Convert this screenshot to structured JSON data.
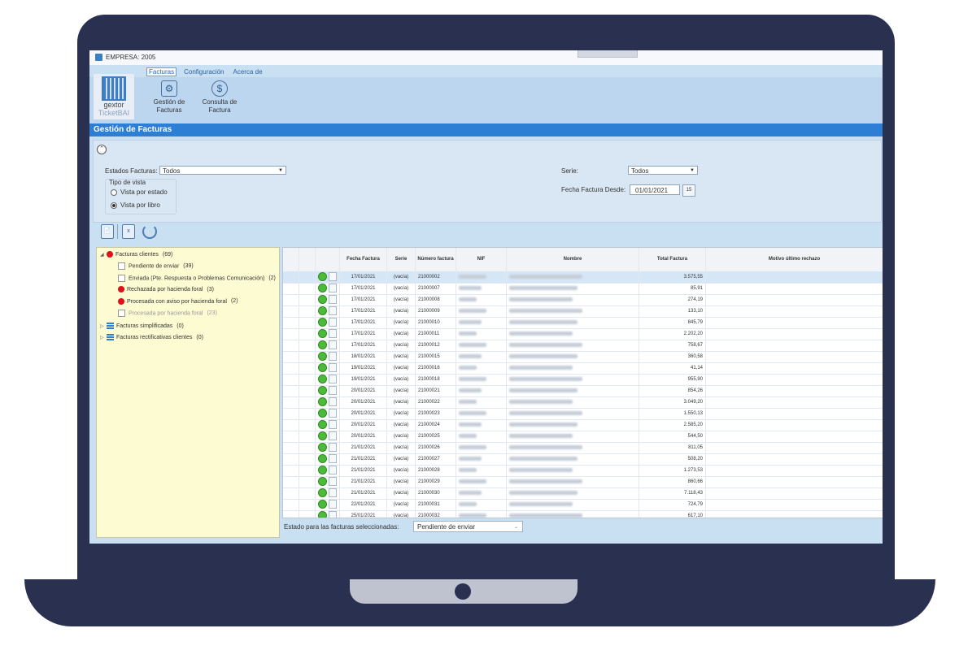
{
  "window": {
    "title": "EMPRESA: 2005"
  },
  "ribbon": {
    "tabs": [
      "Facturas",
      "Configuración",
      "Acerca de"
    ],
    "active_tab": "Facturas",
    "logo": {
      "line1": "gextor",
      "line2": "TicketBAI"
    },
    "buttons": [
      {
        "label1": "Gestión de",
        "label2": "Facturas",
        "icon": "invoice-gear-icon"
      },
      {
        "label1": "Consulta de",
        "label2": "Factura",
        "icon": "invoice-search-icon"
      }
    ]
  },
  "section": {
    "title": "Gestión de Facturas"
  },
  "filters": {
    "estados_label": "Estados Facturas:",
    "estados_value": "Todos",
    "tipo_vista_label": "Tipo de vista",
    "radio_estado": "Vista por estado",
    "radio_libro": "Vista por libro",
    "selected_view": "Vista por libro",
    "serie_label": "Serie:",
    "serie_value": "Todos",
    "fecha_label": "Fecha Factura Desde:",
    "fecha_value": "01/01/2021",
    "cal_label": "15"
  },
  "tree": {
    "root": {
      "label": "Facturas clientes",
      "count": "(69)"
    },
    "children": [
      {
        "label": "Pendiente de enviar",
        "count": "(39)",
        "icon": "checkbox"
      },
      {
        "label": "Enviada (Pte. Respuesta o Problemas Comunicación)",
        "count": "(2)",
        "icon": "checkbox"
      },
      {
        "label": "Rechazada por hacienda foral",
        "count": "(3)",
        "icon": "red"
      },
      {
        "label": "Procesada con aviso por hacienda foral",
        "count": "(2)",
        "icon": "red"
      },
      {
        "label": "Procesada por hacienda foral",
        "count": "(23)",
        "icon": "checkbox-dim"
      }
    ],
    "others": [
      {
        "label": "Facturas simplificadas",
        "count": "(0)"
      },
      {
        "label": "Facturas rectificativas clientes",
        "count": "(0)"
      }
    ]
  },
  "grid": {
    "headers": [
      "Fecha Factura",
      "Serie",
      "Número factura",
      "NIF",
      "Nombre",
      "Total Factura",
      "Motivo último rechazo"
    ],
    "rows": [
      {
        "fecha": "17/01/2021",
        "serie": "(vacía)",
        "numero": "21000002",
        "total": "3.575,55"
      },
      {
        "fecha": "17/01/2021",
        "serie": "(vacía)",
        "numero": "21000007",
        "total": "85,91"
      },
      {
        "fecha": "17/01/2021",
        "serie": "(vacía)",
        "numero": "21000008",
        "total": "274,19"
      },
      {
        "fecha": "17/01/2021",
        "serie": "(vacía)",
        "numero": "21000009",
        "total": "133,10"
      },
      {
        "fecha": "17/01/2021",
        "serie": "(vacía)",
        "numero": "21000010",
        "total": "845,79"
      },
      {
        "fecha": "17/01/2021",
        "serie": "(vacía)",
        "numero": "21000011",
        "total": "2.202,20"
      },
      {
        "fecha": "17/01/2021",
        "serie": "(vacía)",
        "numero": "21000012",
        "total": "758,67"
      },
      {
        "fecha": "18/01/2021",
        "serie": "(vacía)",
        "numero": "21000015",
        "total": "360,58"
      },
      {
        "fecha": "19/01/2021",
        "serie": "(vacía)",
        "numero": "21000016",
        "total": "41,14"
      },
      {
        "fecha": "19/01/2021",
        "serie": "(vacía)",
        "numero": "21000018",
        "total": "955,90"
      },
      {
        "fecha": "20/01/2021",
        "serie": "(vacía)",
        "numero": "21000021",
        "total": "854,26"
      },
      {
        "fecha": "20/01/2021",
        "serie": "(vacía)",
        "numero": "21000022",
        "total": "3.049,20"
      },
      {
        "fecha": "20/01/2021",
        "serie": "(vacía)",
        "numero": "21000023",
        "total": "1.550,13"
      },
      {
        "fecha": "20/01/2021",
        "serie": "(vacía)",
        "numero": "21000024",
        "total": "2.585,20"
      },
      {
        "fecha": "20/01/2021",
        "serie": "(vacía)",
        "numero": "21000025",
        "total": "544,50"
      },
      {
        "fecha": "21/01/2021",
        "serie": "(vacía)",
        "numero": "21000026",
        "total": "811,05"
      },
      {
        "fecha": "21/01/2021",
        "serie": "(vacía)",
        "numero": "21000027",
        "total": "508,20"
      },
      {
        "fecha": "21/01/2021",
        "serie": "(vacía)",
        "numero": "21000028",
        "total": "1.273,53"
      },
      {
        "fecha": "21/01/2021",
        "serie": "(vacía)",
        "numero": "21000029",
        "total": "860,66"
      },
      {
        "fecha": "21/01/2021",
        "serie": "(vacía)",
        "numero": "21000030",
        "total": "7.118,43"
      },
      {
        "fecha": "22/01/2021",
        "serie": "(vacía)",
        "numero": "21000031",
        "total": "724,79"
      },
      {
        "fecha": "25/01/2021",
        "serie": "(vacía)",
        "numero": "21000032",
        "total": "617,10"
      }
    ]
  },
  "footer": {
    "label": "Estado para las facturas seleccionadas:",
    "select_value": "Pendiente de enviar"
  },
  "colors": {
    "accent": "#2d7fd6",
    "tree_bg": "#fdfbd2",
    "status_ok": "#4cbb3a",
    "status_error": "#e10e1b"
  }
}
